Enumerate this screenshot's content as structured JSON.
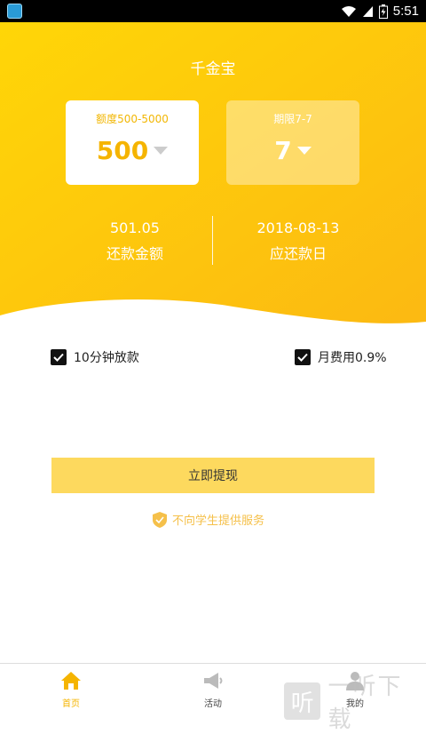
{
  "status_bar": {
    "time": "5:51"
  },
  "header": {
    "title": "千金宝"
  },
  "amount_card": {
    "label": "额度500-5000",
    "value": "500"
  },
  "term_card": {
    "label": "期限7-7",
    "value": "7"
  },
  "summary": {
    "repay_amount_value": "501.05",
    "repay_amount_label": "还款金额",
    "due_date_value": "2018-08-13",
    "due_date_label": "应还款日"
  },
  "options": {
    "fast_loan_label": "10分钟放款",
    "monthly_fee_label": "月费用0.9%"
  },
  "submit_label": "立即提现",
  "notice": "不向学生提供服务",
  "tabs": [
    {
      "label": "首页",
      "icon": "home-icon"
    },
    {
      "label": "活动",
      "icon": "megaphone-icon"
    },
    {
      "label": "我的",
      "icon": "user-icon"
    }
  ],
  "watermark": {
    "box": "听",
    "text": "一听下载"
  },
  "colors": {
    "accent": "#fdc70c",
    "button": "#fdd95e",
    "notice": "#f5c04a"
  }
}
